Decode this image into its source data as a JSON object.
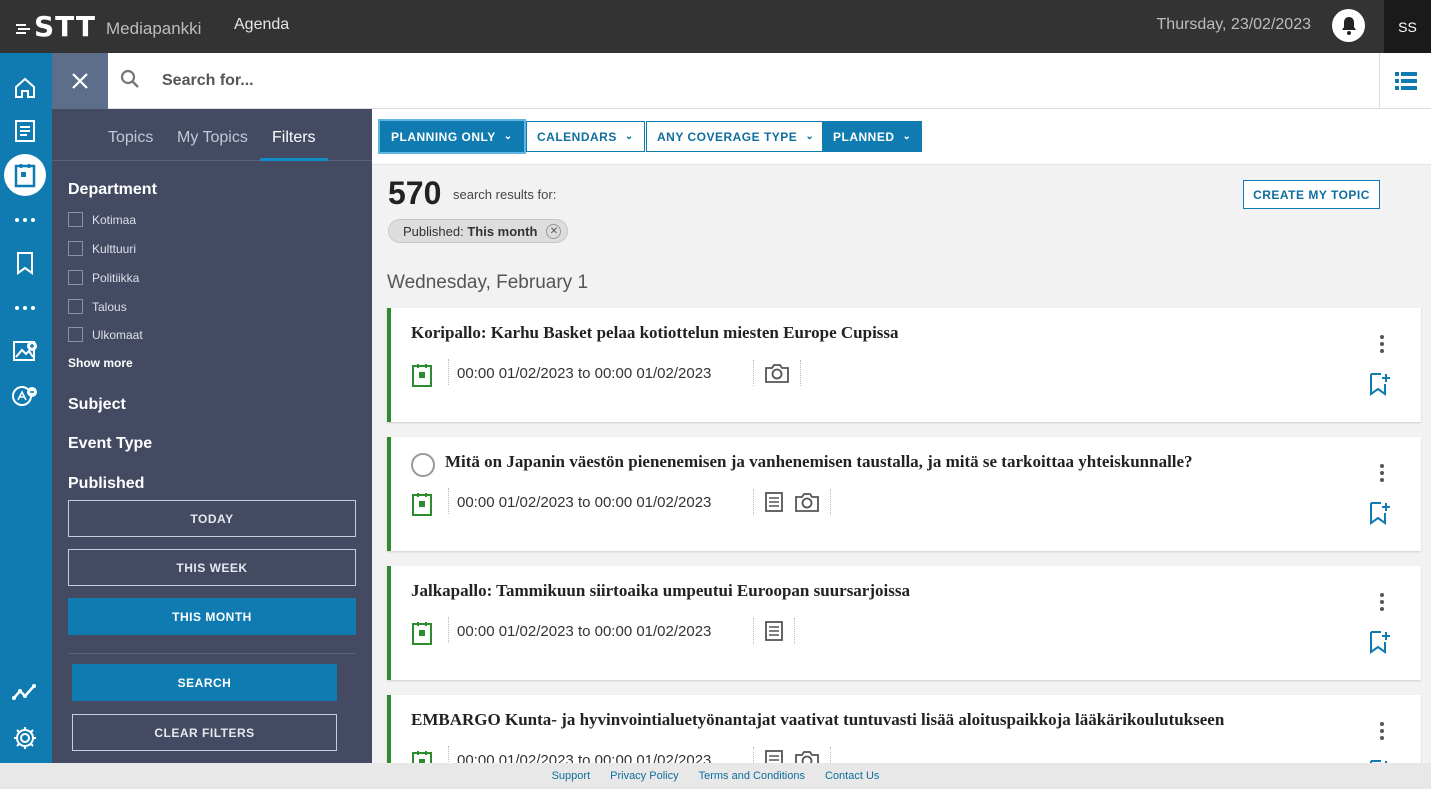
{
  "app": {
    "logo": "STT",
    "name": "Mediapankki",
    "section": "Agenda",
    "date": "Thursday, 23/02/2023",
    "user_initials": "SS"
  },
  "search": {
    "placeholder": "Search for..."
  },
  "sidebar_tabs": [
    {
      "label": "Topics"
    },
    {
      "label": "My Topics"
    },
    {
      "label": "Filters",
      "active": true
    }
  ],
  "filters": {
    "department": {
      "title": "Department",
      "options": [
        "Kotimaa",
        "Kulttuuri",
        "Politiikka",
        "Talous",
        "Ulkomaat"
      ],
      "show_more": "Show more"
    },
    "subject": {
      "title": "Subject"
    },
    "event_type": {
      "title": "Event Type"
    },
    "published": {
      "title": "Published",
      "options": [
        "TODAY",
        "THIS WEEK",
        "THIS MONTH"
      ],
      "selected": "THIS MONTH"
    },
    "search_label": "SEARCH",
    "clear_label": "CLEAR FILTERS"
  },
  "filterbar": [
    {
      "label": "PLANNING ONLY",
      "active": true
    },
    {
      "label": "CALENDARS",
      "active": false
    },
    {
      "label": "ANY COVERAGE TYPE",
      "active": false
    },
    {
      "label": "PLANNED",
      "active": true
    }
  ],
  "results": {
    "count": "570",
    "text": "search results for:",
    "create_topic": "CREATE MY TOPIC",
    "chip_key": "Published:",
    "chip_value": "This month",
    "chip_close": "✕"
  },
  "day_heading": "Wednesday, February 1",
  "cards": [
    {
      "title": "Koripallo: Karhu Basket pelaa kotiottelun miesten Europe Cupissa",
      "time": "00:00 01/02/2023 to 00:00 01/02/2023",
      "coverage": [
        "camera-icon"
      ],
      "radio": false
    },
    {
      "title": "Mitä on Japanin väestön pienenemisen ja vanhenemisen taustalla, ja mitä se tarkoittaa yhteiskunnalle?",
      "time": "00:00 01/02/2023 to 00:00 01/02/2023",
      "coverage": [
        "text-icon",
        "camera-icon"
      ],
      "radio": true
    },
    {
      "title": "Jalkapallo: Tammikuun siirtoaika umpeutui Euroopan suursarjoissa",
      "time": "00:00 01/02/2023 to 00:00 01/02/2023",
      "coverage": [
        "text-icon"
      ],
      "radio": false
    },
    {
      "title": "EMBARGO Kunta- ja hyvinvointialuetyönantajat vaativat tuntuvasti lisää aloituspaikkoja lääkärikoulutukseen",
      "time": "00:00 01/02/2023 to 00:00 01/02/2023",
      "coverage": [
        "text-icon",
        "camera-icon"
      ],
      "radio": false
    }
  ],
  "footer": {
    "links": [
      "Support",
      "Privacy Policy",
      "Terms and Conditions",
      "Contact Us"
    ]
  },
  "colors": {
    "brand_blue": "#0f7bb0",
    "panel_bg": "#434a61",
    "topbar_bg": "#333333",
    "planning_green": "#2e8b2e"
  }
}
